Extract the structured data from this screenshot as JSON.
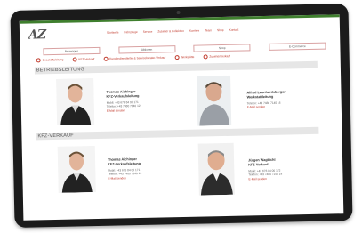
{
  "header": {
    "logo_text": "AZ",
    "nav": [
      "Startseite",
      "Fahrzeuge",
      "Service",
      "Zubehör & Kollektion",
      "Karriere",
      "Team",
      "Shop",
      "Kontakt"
    ]
  },
  "buttons": [
    "Neuwagen",
    "Aktionen",
    "Shop",
    "E-Commerce"
  ],
  "links": [
    "Geschäftsleitung",
    "KFZ-Verkauf",
    "Kundendienstleiter & Serviceberater-Verkauf",
    "Werkstätte",
    "Zubehör/Verkauf"
  ],
  "sections": {
    "betrieb": "BETRIEBSLEITUNG",
    "verkauf": "KFZ-VERKAUF"
  },
  "people": [
    {
      "name": "Thomas Aichinger",
      "role": "KFZ-Verkaufsleitung",
      "phone1": "Mobil: +43 676 84 00 171",
      "phone2": "Telefon: +43 7480 7140 12",
      "email": "E-Mail senden"
    },
    {
      "name": "Alfred Leonhardsberger",
      "role": "Werkstattleitung",
      "phone1": "Telefon: +43 7480 7140 16",
      "phone2": "",
      "email": "E-Mail senden"
    },
    {
      "name": "Thomas Aichinger",
      "role": "KFZ-Verkaufsleitung",
      "phone1": "Mobil: +43 676 84 00 171",
      "phone2": "Telefon: +43 7480 7140 12",
      "email": "E-Mail senden"
    },
    {
      "name": "Jürgen Wagbichl",
      "role": "KFZ-Verkauf",
      "phone1": "Mobil: +43 676 84 00 172",
      "phone2": "Telefon: +43 7480 7140 14",
      "email": "E-Mail senden"
    }
  ],
  "colors": {
    "accent": "#c0392b",
    "topbar": "#3f7f2e",
    "section_bg": "#e6e6e6"
  }
}
